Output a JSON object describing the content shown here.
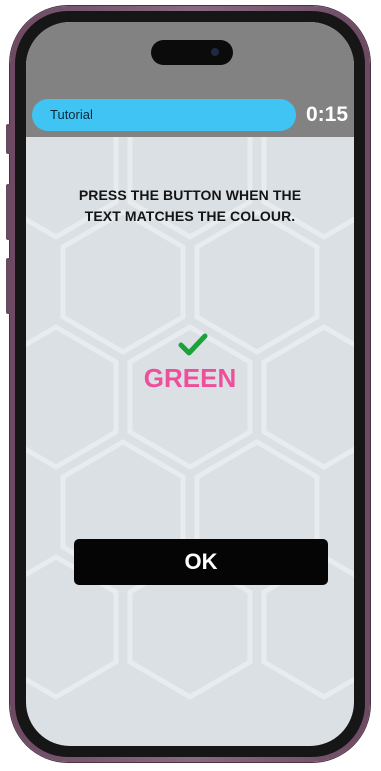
{
  "header": {
    "mode_label": "Tutorial",
    "timer": "0:15"
  },
  "game": {
    "instruction_lines": [
      "PRESS THE BUTTON WHEN THE",
      "TEXT MATCHES THE COLOUR."
    ],
    "word": "GREEN",
    "word_color": "#ee4f9a",
    "feedback_icon": "checkmark-icon",
    "feedback_color": "#1aa33a"
  },
  "actions": {
    "ok_label": "OK"
  },
  "colors": {
    "accent": "#3fc4f4",
    "background": "#dbe0e4",
    "topbar": "#828282",
    "button": "#050505"
  }
}
